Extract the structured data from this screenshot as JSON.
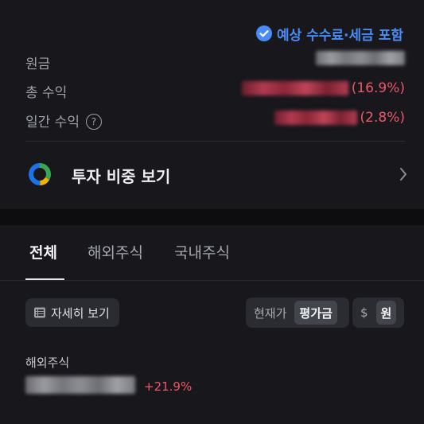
{
  "summary": {
    "fee_note": "예상 수수료·세금 포함",
    "principal_label": "원금",
    "total_return_label": "총 수익",
    "total_return_pct": "(16.9%)",
    "daily_return_label": "일간 수익",
    "daily_return_pct": "(2.8%)",
    "help_glyph": "?"
  },
  "allocation": {
    "label": "투자 비중 보기"
  },
  "tabs": [
    {
      "label": "전체",
      "active": true
    },
    {
      "label": "해외주식",
      "active": false
    },
    {
      "label": "국내주식",
      "active": false
    }
  ],
  "toolbar": {
    "detail_label": "자세히 보기",
    "price_toggle": [
      "현재가",
      "평가금"
    ],
    "price_selected": "평가금",
    "currency_toggle": [
      "$",
      "원"
    ],
    "currency_selected": "원"
  },
  "holdings": {
    "section_label": "해외주식",
    "first_pct": "+21.9%"
  },
  "colors": {
    "accent_blue": "#4a8cf5",
    "loss_red": "#f0566a",
    "background": "#17171c"
  }
}
